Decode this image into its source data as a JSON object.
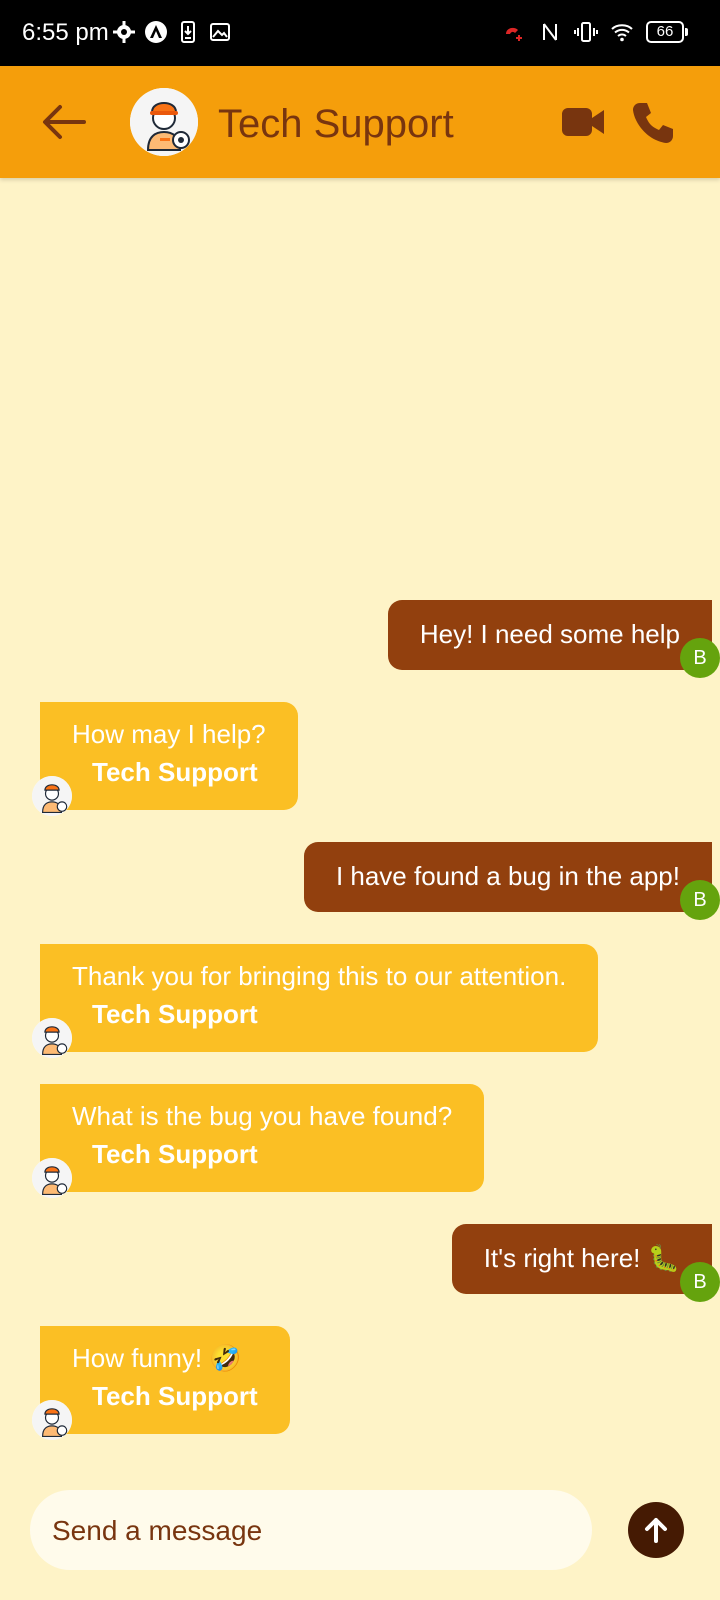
{
  "status_bar": {
    "time": "6:55 pm",
    "battery": "66",
    "icons_left": [
      "settings-icon",
      "app-icon",
      "download-icon",
      "image-icon"
    ],
    "icons_right": [
      "call-alert-icon",
      "nfc-icon",
      "vibrate-icon",
      "wifi-icon",
      "battery-icon"
    ]
  },
  "header": {
    "title": "Tech Support",
    "back_icon": "arrow-left-icon",
    "video_icon": "video-camera-icon",
    "call_icon": "phone-icon",
    "accent": "#f59e0b",
    "title_color": "#78350f"
  },
  "messages": [
    {
      "direction": "outgoing",
      "text": "Hey! I need some help",
      "avatar_letter": "B"
    },
    {
      "direction": "incoming",
      "text": "How may I help?",
      "sender": "Tech Support"
    },
    {
      "direction": "outgoing",
      "text": "I have found a bug in the app!",
      "avatar_letter": "B"
    },
    {
      "direction": "incoming",
      "text": "Thank you for bringing this to our attention.",
      "sender": "Tech Support"
    },
    {
      "direction": "incoming",
      "text": "What is the bug you have found?",
      "sender": "Tech Support"
    },
    {
      "direction": "outgoing",
      "text": "It's right here! 🐛",
      "avatar_letter": "B"
    },
    {
      "direction": "incoming",
      "text": "How funny! 🤣",
      "sender": "Tech Support"
    }
  ],
  "composer": {
    "placeholder": "Send a message",
    "send_icon": "arrow-up-icon"
  },
  "colors": {
    "background": "#fef3c7",
    "outgoing_bubble": "#92400e",
    "incoming_bubble": "#fbbf24",
    "user_badge": "#65a30d",
    "send_button": "#451a03"
  }
}
